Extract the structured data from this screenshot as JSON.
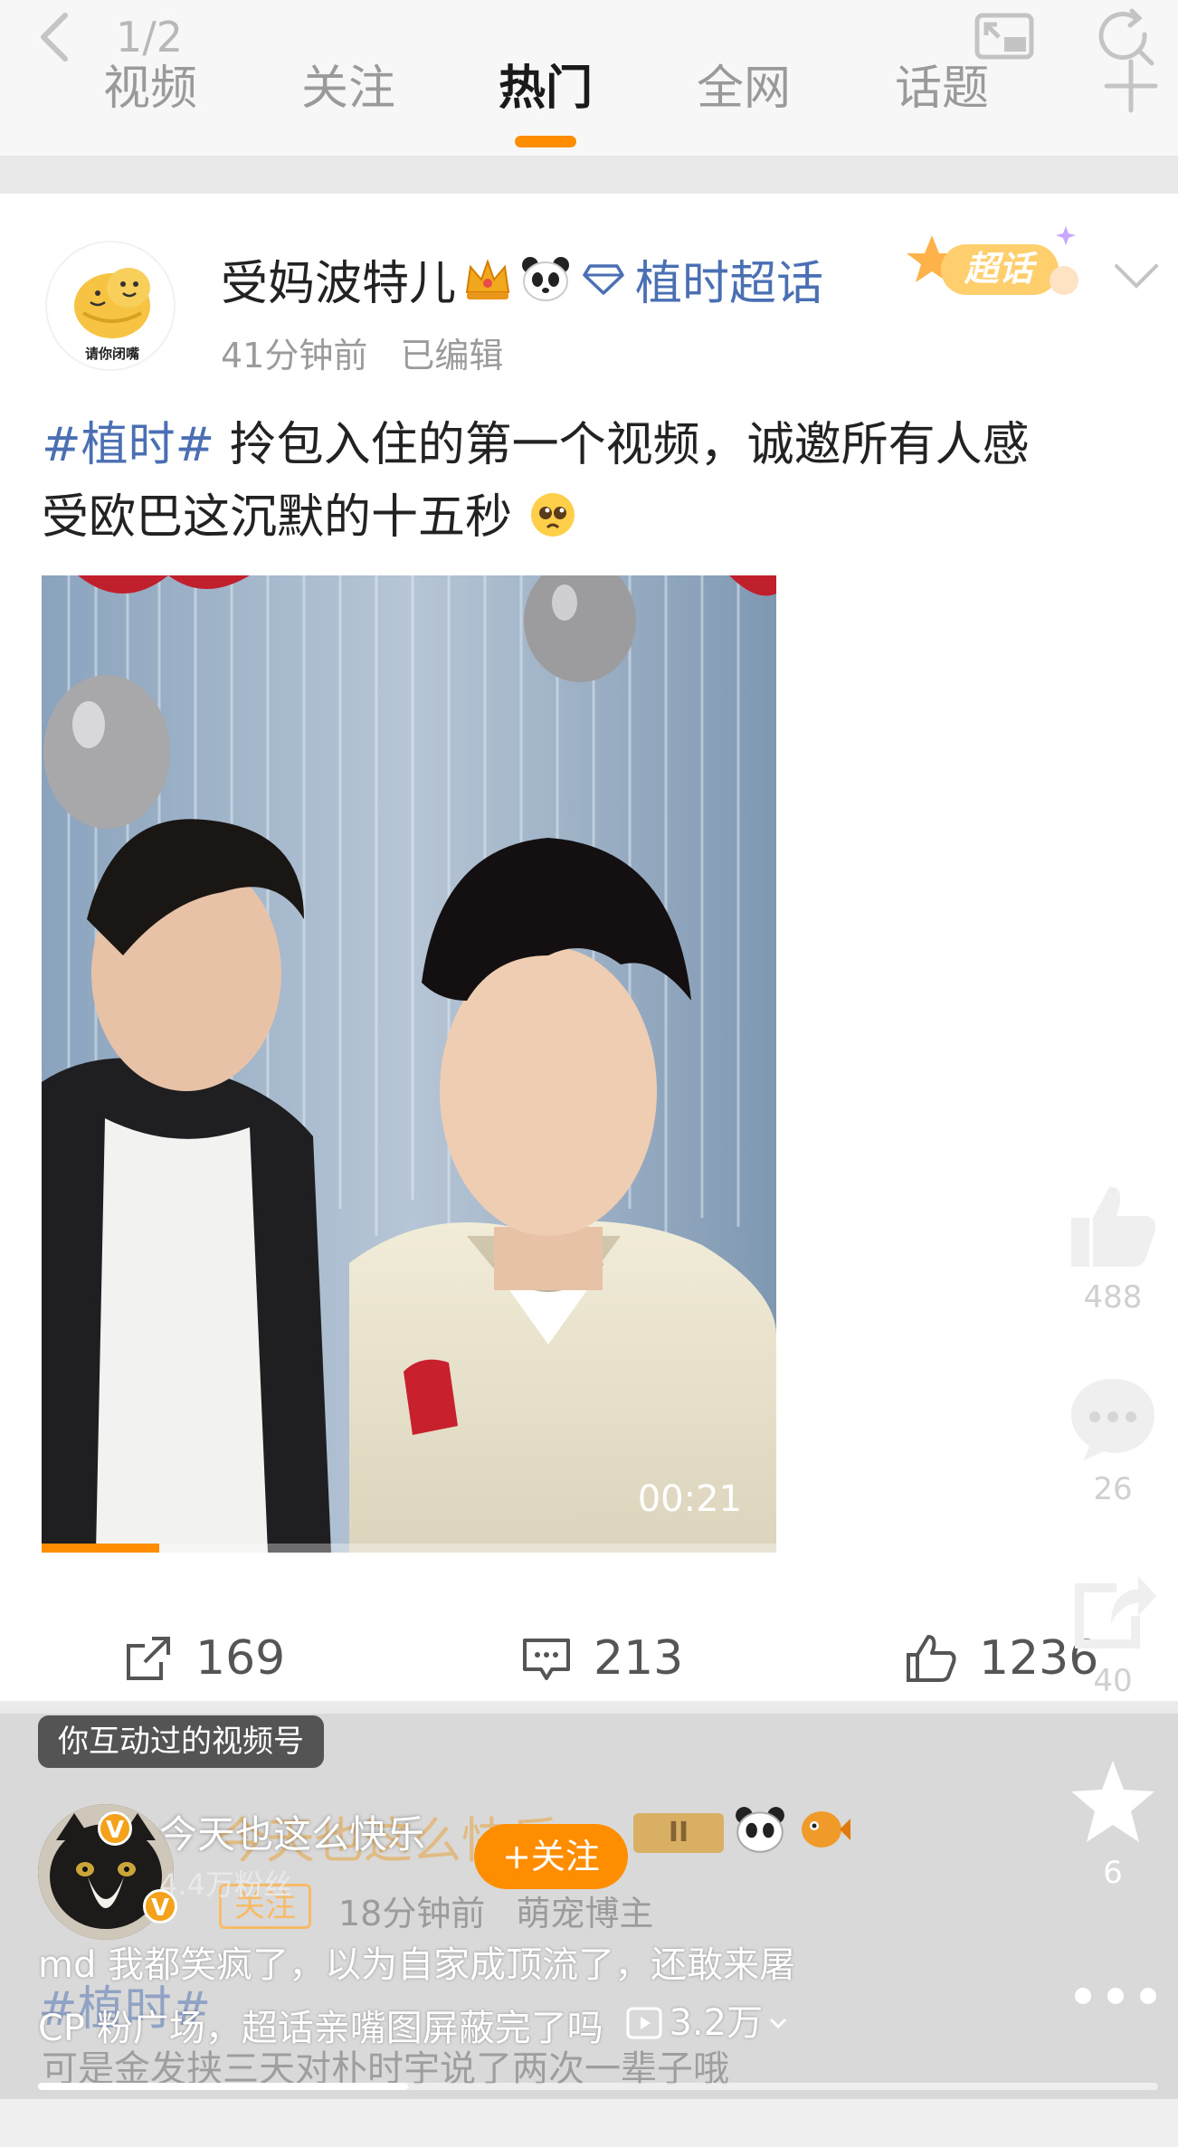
{
  "header": {
    "counter": "1/2",
    "tabs": [
      {
        "label": "视频"
      },
      {
        "label": "关注"
      },
      {
        "label": "热门",
        "active": true
      },
      {
        "label": "全网"
      },
      {
        "label": "话题"
      }
    ],
    "icons": [
      "back-arrow-icon",
      "pip-icon",
      "refresh-search-icon",
      "plus-icon"
    ],
    "accent_color": "#ff8d00"
  },
  "post": {
    "author": "受妈波特儿",
    "badges": [
      "crown-emoji",
      "panda-emoji",
      "diamond-icon"
    ],
    "supertopic_name": "植时超话",
    "supertopic_badge": "超话",
    "avatar_caption": "请你闭嘴",
    "time_ago": "41分钟前",
    "edited": "已编辑",
    "hashtag": "#植时#",
    "text_line1": " 拎包入住的第一个视频，诚邀所有人感",
    "text_line2": "受欧巴这沉默的十五秒",
    "video_duration": "00:21",
    "video_progress": 0.16,
    "actions": {
      "reposts": "169",
      "comments": "213",
      "likes": "1236"
    },
    "link_color": "#4a6fb3"
  },
  "rail": {
    "likes": "488",
    "comments": "26",
    "shares": "40",
    "favorites": "6"
  },
  "overlay": {
    "tag_chip": "你互动过的视频号",
    "creator_name": "今天也这么快乐",
    "creator_fans": "4.4万粉丝",
    "follow_label": "+关注",
    "ghost_name": "今天也这么快乐",
    "ghost_level": "II",
    "ghost_follow": "关注",
    "ghost_time": "18分钟前",
    "ghost_role": "萌宠博主",
    "description_line1": "md 我都笑疯了，以为自家成顶流了，还敢来屠",
    "description_line2": "CP 粉广场，超话亲嘴图屏蔽完了吗",
    "views": "3.2万",
    "ghost_hashtag": "#植时#",
    "ghost_text": "可是金发挟三天对朴时宇说了两次一辈子哦",
    "scrub_progress": 0.33
  }
}
